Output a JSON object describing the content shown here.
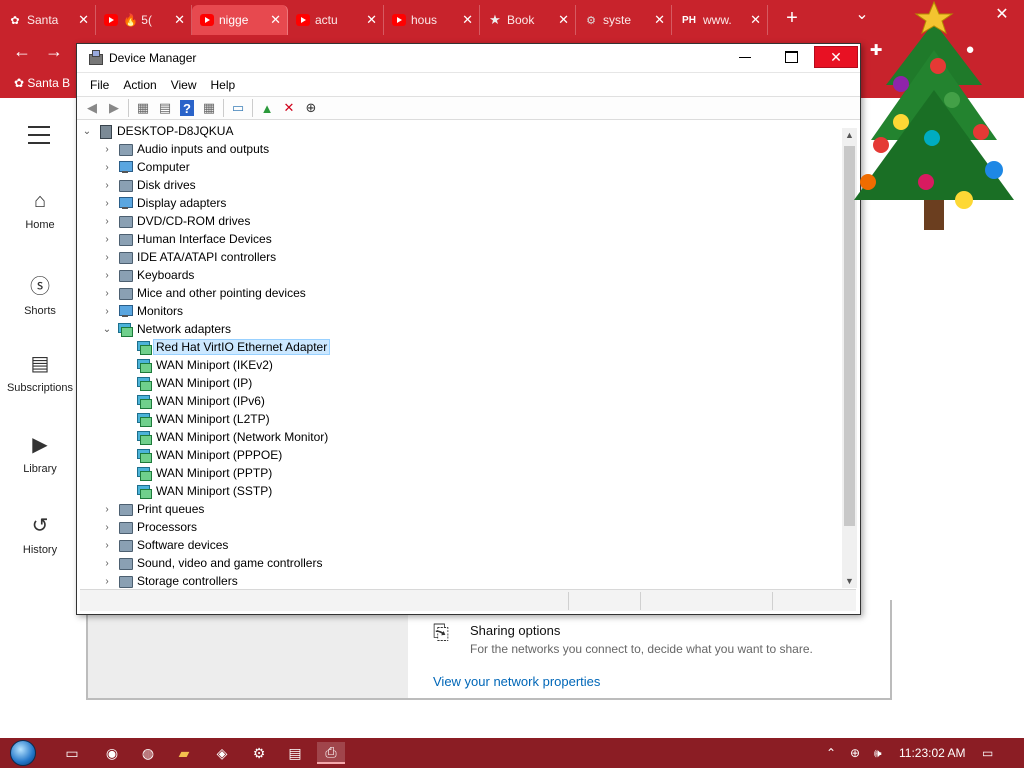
{
  "browser": {
    "tabs": [
      {
        "title": "Santa",
        "icon": "santa-icon",
        "active": false
      },
      {
        "title": "🔥 5(",
        "icon": "youtube-icon",
        "active": false
      },
      {
        "title": "nigge",
        "icon": "youtube-icon",
        "active": true
      },
      {
        "title": "actu",
        "icon": "youtube-icon",
        "active": false
      },
      {
        "title": "hous",
        "icon": "youtube-icon",
        "active": false
      },
      {
        "title": "Book",
        "icon": "star-icon",
        "active": false
      },
      {
        "title": "syste",
        "icon": "settings-icon",
        "active": false
      },
      {
        "title": "www.",
        "icon": "ph-icon",
        "active": false
      }
    ],
    "bookmark": "Santa B"
  },
  "youtube_nav": {
    "items": [
      {
        "label": "Home",
        "icon": "home-icon"
      },
      {
        "label": "Shorts",
        "icon": "shorts-icon"
      },
      {
        "label": "Subscriptions",
        "icon": "subscriptions-icon"
      },
      {
        "label": "Library",
        "icon": "library-icon"
      },
      {
        "label": "History",
        "icon": "history-icon"
      }
    ]
  },
  "settings_panel": {
    "sharing_title": "Sharing options",
    "sharing_desc": "For the networks you connect to, decide what you want to share.",
    "network_link": "View your network properties"
  },
  "device_manager": {
    "title": "Device Manager",
    "menu": [
      "File",
      "Action",
      "View",
      "Help"
    ],
    "root": "DESKTOP-D8JQKUA",
    "categories": [
      {
        "label": "Audio inputs and outputs",
        "icon": "speaker-icon",
        "expanded": false
      },
      {
        "label": "Computer",
        "icon": "monitor-icon",
        "expanded": false
      },
      {
        "label": "Disk drives",
        "icon": "disk-icon",
        "expanded": false
      },
      {
        "label": "Display adapters",
        "icon": "display-adapter-icon",
        "expanded": false
      },
      {
        "label": "DVD/CD-ROM drives",
        "icon": "dvd-icon",
        "expanded": false
      },
      {
        "label": "Human Interface Devices",
        "icon": "hid-icon",
        "expanded": false
      },
      {
        "label": "IDE ATA/ATAPI controllers",
        "icon": "ide-icon",
        "expanded": false
      },
      {
        "label": "Keyboards",
        "icon": "keyboard-icon",
        "expanded": false
      },
      {
        "label": "Mice and other pointing devices",
        "icon": "mouse-icon",
        "expanded": false
      },
      {
        "label": "Monitors",
        "icon": "monitor-icon",
        "expanded": false
      },
      {
        "label": "Network adapters",
        "icon": "network-icon",
        "expanded": true,
        "children": [
          "Red Hat VirtIO Ethernet Adapter",
          "WAN Miniport (IKEv2)",
          "WAN Miniport (IP)",
          "WAN Miniport (IPv6)",
          "WAN Miniport (L2TP)",
          "WAN Miniport (Network Monitor)",
          "WAN Miniport (PPPOE)",
          "WAN Miniport (PPTP)",
          "WAN Miniport (SSTP)"
        ]
      },
      {
        "label": "Print queues",
        "icon": "printer-icon",
        "expanded": false
      },
      {
        "label": "Processors",
        "icon": "processor-icon",
        "expanded": false
      },
      {
        "label": "Software devices",
        "icon": "software-device-icon",
        "expanded": false
      },
      {
        "label": "Sound, video and game controllers",
        "icon": "sound-icon",
        "expanded": false
      },
      {
        "label": "Storage controllers",
        "icon": "storage-icon",
        "expanded": false
      }
    ],
    "selected_child": "Red Hat VirtIO Ethernet Adapter"
  },
  "taskbar": {
    "clock": "11:23:02 AM"
  },
  "colors": {
    "browser_red": "#c8232c",
    "taskbar": "#8b1d24",
    "selection": "#cce8ff",
    "link": "#0067b8"
  }
}
